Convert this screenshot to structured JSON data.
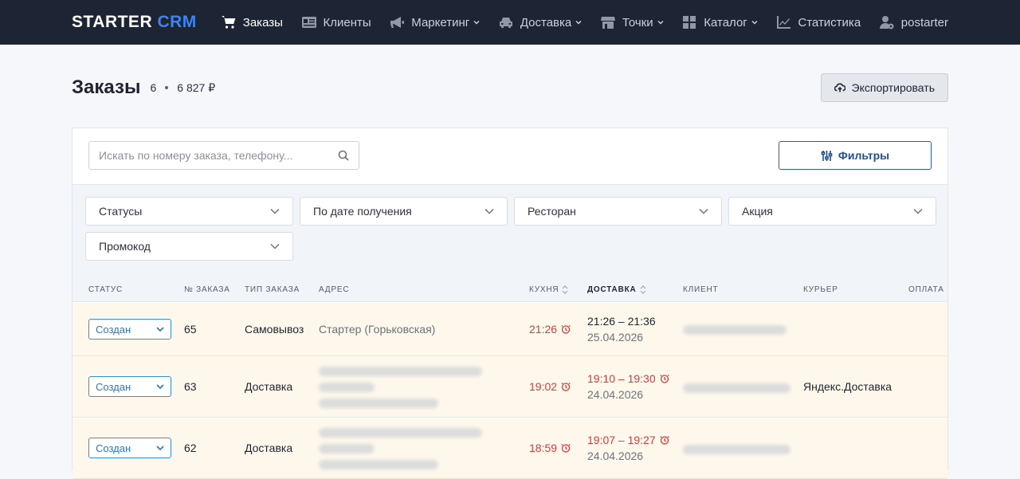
{
  "brand": {
    "name": "STARTER",
    "suffix": "CRM"
  },
  "nav": {
    "orders": "Заказы",
    "clients": "Клиенты",
    "marketing": "Маркетинг",
    "delivery": "Доставка",
    "points": "Точки",
    "catalog": "Каталог",
    "stats": "Статистика",
    "user": "postarter"
  },
  "header": {
    "title": "Заказы",
    "count": "6",
    "sum": "6 827 ₽",
    "export_label": "Экспортировать"
  },
  "search": {
    "placeholder": "Искать по номеру заказа, телефону..."
  },
  "filters_label": "Фильтры",
  "filter_selects": [
    "Статусы",
    "По дате получения",
    "Ресторан",
    "Акция",
    "Промокод"
  ],
  "table": {
    "columns": [
      "Статус",
      "№ заказа",
      "Тип заказа",
      "Адрес",
      "Кухня",
      "Доставка",
      "Клиент",
      "Курьер",
      "Оплата"
    ],
    "rows": [
      {
        "status": "Создан",
        "number": "65",
        "type": "Самовывоз",
        "address": "Стартер (Горьковская)",
        "kitchen": "21:26",
        "delivery_time": "21:26 – 21:36",
        "delivery_date": "25.04.2026",
        "courier": ""
      },
      {
        "status": "Создан",
        "number": "63",
        "type": "Доставка",
        "address": "",
        "kitchen": "19:02",
        "delivery_time": "19:10 – 19:30",
        "delivery_date": "24.04.2026",
        "courier": "Яндекс.Доставка"
      },
      {
        "status": "Создан",
        "number": "62",
        "type": "Доставка",
        "address": "",
        "kitchen": "18:59",
        "delivery_time": "19:07 – 19:27",
        "delivery_date": "24.04.2026",
        "courier": ""
      }
    ]
  },
  "colors": {
    "navbar": "#1d2433",
    "accent": "#3d84f0",
    "row_bg": "#fef8ec",
    "late": "#d83a3a"
  },
  "icons": [
    "cart-icon",
    "id-card-icon",
    "megaphone-icon",
    "car-icon",
    "store-icon",
    "grid-icon",
    "chart-icon",
    "user-gear-icon",
    "cloud-upload-icon",
    "search-icon",
    "sliders-icon",
    "chevron-down-icon",
    "clock-icon",
    "sort-icon"
  ]
}
